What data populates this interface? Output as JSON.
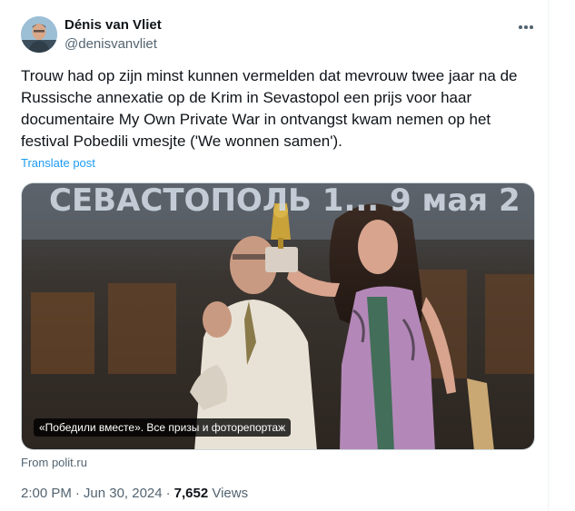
{
  "author": {
    "display_name": "Dénis van Vliet",
    "handle": "@denisvanvliet",
    "avatar_icon": "profile-photo"
  },
  "tweet": {
    "text": "Trouw had op zijn minst kunnen vermelden dat mevrouw twee jaar na de\nRussische annexatie op de Krim in Sevastopol een prijs voor haar\ndocumentaire My Own Private War in ontvangst kwam nemen op het\nfestival Pobedili vmesjte ('We wonnen samen').",
    "translate_label": "Translate post"
  },
  "media": {
    "banner_text": "СЕВАСТОПОЛЬ 1... 9 мая 2",
    "caption": "«Победили вместе». Все призы и фоторепортаж",
    "source": "From polit.ru"
  },
  "meta": {
    "time": "2:00 PM",
    "separator": "·",
    "date": "Jun 30, 2024",
    "views_count": "7,652",
    "views_label": "Views"
  },
  "menu": {
    "icon": "more-horizontal-icon"
  },
  "colors": {
    "accent": "#1d9bf0",
    "secondary_text": "#536471",
    "primary_text": "#0f1419"
  }
}
